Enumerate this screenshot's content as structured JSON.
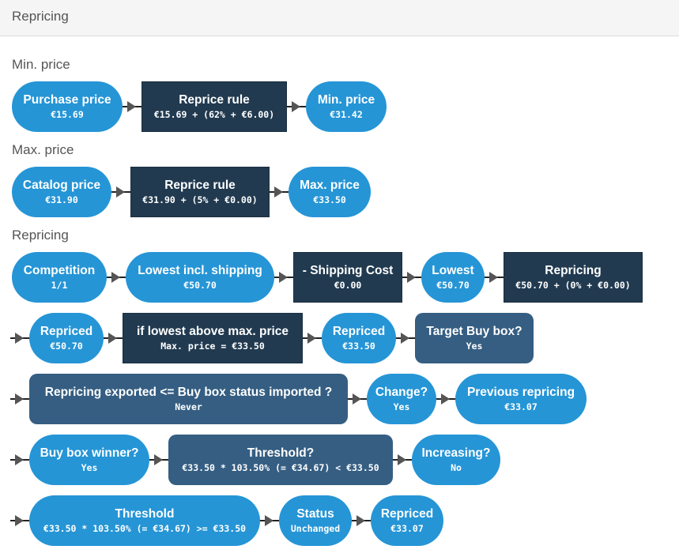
{
  "header": {
    "title": "Repricing"
  },
  "sections": {
    "min": {
      "title": "Min. price",
      "nodes": [
        {
          "label": "Purchase price",
          "value": "€15.69"
        },
        {
          "label": "Reprice rule",
          "value": "€15.69 + (62% + €6.00)"
        },
        {
          "label": "Min. price",
          "value": "€31.42"
        }
      ]
    },
    "max": {
      "title": "Max. price",
      "nodes": [
        {
          "label": "Catalog price",
          "value": "€31.90"
        },
        {
          "label": "Reprice rule",
          "value": "€31.90 + (5% + €0.00)"
        },
        {
          "label": "Max. price",
          "value": "€33.50"
        }
      ]
    },
    "repricing": {
      "title": "Repricing",
      "row1": [
        {
          "label": "Competition",
          "value": "1/1"
        },
        {
          "label": "Lowest incl. shipping",
          "value": "€50.70"
        },
        {
          "label": "- Shipping Cost",
          "value": "€0.00"
        },
        {
          "label": "Lowest",
          "value": "€50.70"
        },
        {
          "label": "Repricing",
          "value": "€50.70 + (0% + €0.00)"
        }
      ],
      "row2": [
        {
          "label": "Repriced",
          "value": "€50.70"
        },
        {
          "label": "if lowest above max. price",
          "value": "Max. price = €33.50"
        },
        {
          "label": "Repriced",
          "value": "€33.50"
        },
        {
          "label": "Target Buy box?",
          "value": "Yes"
        }
      ],
      "row3": [
        {
          "label": "Repricing exported <= Buy box status imported ?",
          "value": "Never"
        },
        {
          "label": "Change?",
          "value": "Yes"
        },
        {
          "label": "Previous repricing",
          "value": "€33.07"
        }
      ],
      "row4": [
        {
          "label": "Buy box winner?",
          "value": "Yes"
        },
        {
          "label": "Threshold?",
          "value": "€33.50 * 103.50% (= €34.67) < €33.50"
        },
        {
          "label": "Increasing?",
          "value": "No"
        }
      ],
      "row5": [
        {
          "label": "Threshold",
          "value": "€33.50 * 103.50% (= €34.67) >= €33.50"
        },
        {
          "label": "Status",
          "value": "Unchanged"
        },
        {
          "label": "Repriced",
          "value": "€33.07"
        }
      ]
    }
  },
  "colors": {
    "pill": "#2595d6",
    "process": "#213a50",
    "decision": "#355e82"
  }
}
